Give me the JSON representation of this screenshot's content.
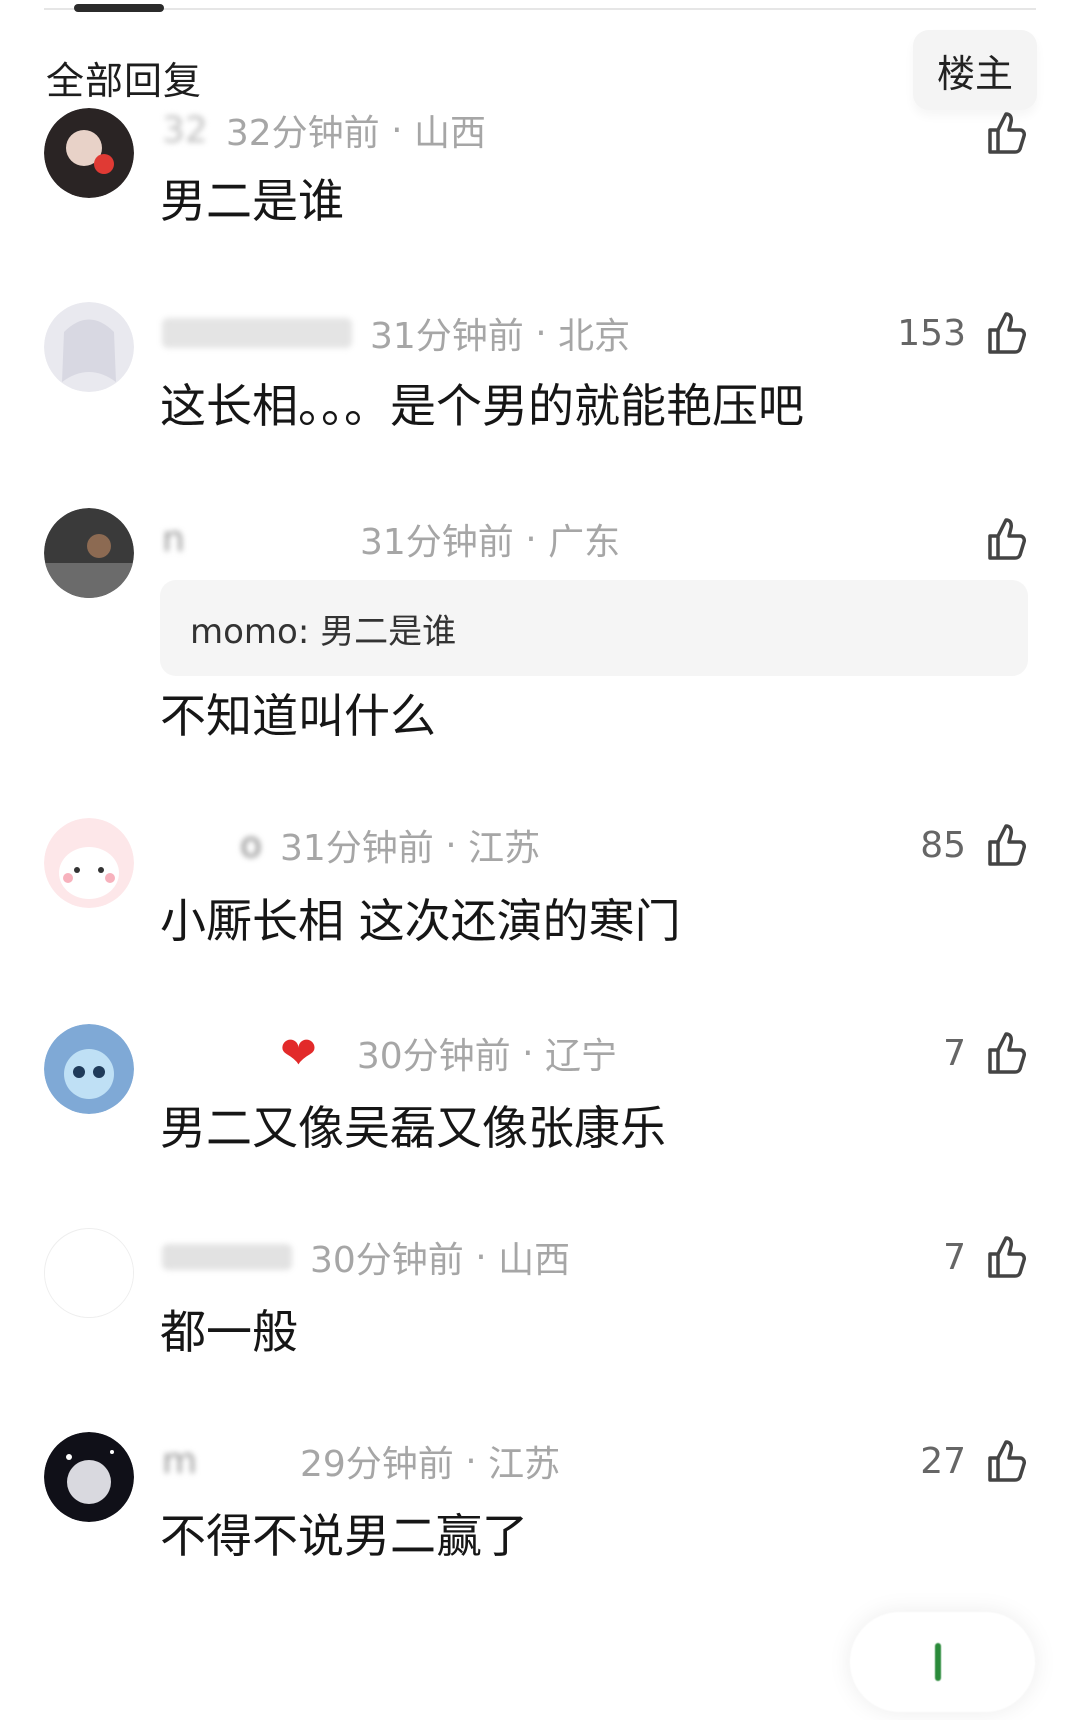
{
  "header": {
    "title": "全部回复",
    "op_filter_label": "楼主"
  },
  "comments": [
    {
      "user": "32",
      "time": "32分钟前",
      "region": "山西",
      "likes": "",
      "text": "男二是谁"
    },
    {
      "user": "",
      "time": "31分钟前",
      "region": "北京",
      "likes": "153",
      "text": "这长相。。。是个男的就能艳压吧"
    },
    {
      "user": "n",
      "time": "31分钟前",
      "region": "广东",
      "likes": "",
      "quote": "momo: 男二是谁",
      "text": "不知道叫什么"
    },
    {
      "user": "o",
      "time": "31分钟前",
      "region": "江苏",
      "likes": "85",
      "text": "小厮长相 这次还演的寒门"
    },
    {
      "user": "",
      "time": "30分钟前",
      "region": "辽宁",
      "likes": "7",
      "text": "男二又像吴磊又像张康乐"
    },
    {
      "user": "",
      "time": "30分钟前",
      "region": "山西",
      "likes": "7",
      "text": "都一般"
    },
    {
      "user": "m",
      "time": "29分钟前",
      "region": "江苏",
      "likes": "27",
      "text": "不得不说男二赢了"
    }
  ],
  "colors": {
    "accent": "#161616",
    "meta": "#a6a6a6",
    "quote_bg": "#f5f5f5"
  },
  "icons": {
    "like": "thumbs-up-icon"
  }
}
